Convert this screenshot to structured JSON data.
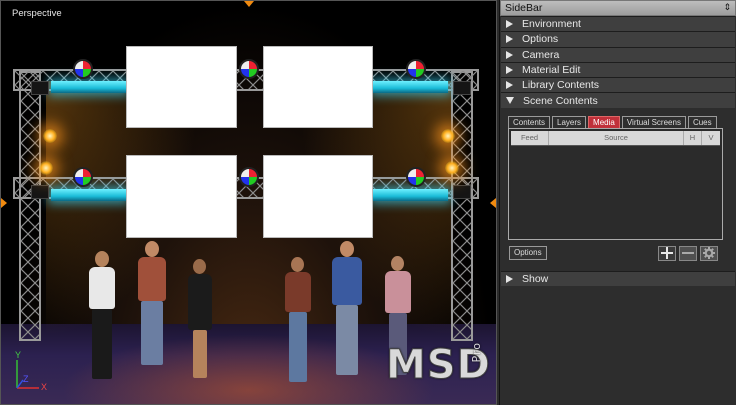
{
  "viewport": {
    "label": "Perspective",
    "axis": {
      "y": "Y",
      "z": "Z",
      "x": "X"
    },
    "logo": {
      "main": "MSD",
      "sub": "Pro"
    },
    "colors": {
      "led": "#3fd8f5",
      "spot": "#ffb020",
      "floor": "#2c2150"
    }
  },
  "sidebar": {
    "title": "SideBar",
    "pin_icon": "pin-icon",
    "sections": [
      {
        "label": "Environment",
        "expanded": false
      },
      {
        "label": "Options",
        "expanded": false
      },
      {
        "label": "Camera",
        "expanded": false
      },
      {
        "label": "Material Edit",
        "expanded": false
      },
      {
        "label": "Library Contents",
        "expanded": false
      },
      {
        "label": "Scene Contents",
        "expanded": true
      }
    ],
    "scene_contents": {
      "tabs": [
        {
          "label": "Contents",
          "active": false
        },
        {
          "label": "Layers",
          "active": false
        },
        {
          "label": "Media",
          "active": true
        },
        {
          "label": "Virtual Screens",
          "active": false
        },
        {
          "label": "Cues",
          "active": false
        }
      ],
      "columns": [
        "Feed",
        "Source",
        "H",
        "V"
      ],
      "options_label": "Options",
      "active_tab_color": "#c0303a"
    },
    "show": {
      "label": "Show",
      "expanded": false
    }
  }
}
